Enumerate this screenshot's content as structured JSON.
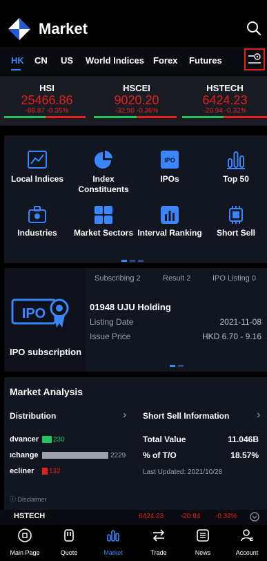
{
  "header": {
    "title": "Market",
    "search_icon": "search-icon"
  },
  "tabs": [
    {
      "label": "HK"
    },
    {
      "label": "CN"
    },
    {
      "label": "US"
    },
    {
      "label": "World Indices"
    },
    {
      "label": "Forex"
    },
    {
      "label": "Futures"
    }
  ],
  "indices": [
    {
      "name": "HSI",
      "value": "25466.86",
      "change": "-88.87 -0.35%"
    },
    {
      "name": "HSCEI",
      "value": "9020.20",
      "change": "-32.50 -0.36%"
    },
    {
      "name": "HSTECH",
      "value": "6424.23",
      "change": "-20.94 -0.32%"
    }
  ],
  "grid": [
    {
      "label": "Local Indices",
      "icon": "chart-line-icon"
    },
    {
      "label": "Index Constituents",
      "icon": "pie-chart-icon"
    },
    {
      "label": "IPOs",
      "icon": "ipo-icon"
    },
    {
      "label": "Top 50",
      "icon": "bar-chart-icon"
    },
    {
      "label": "Industries",
      "icon": "briefcase-icon"
    },
    {
      "label": "Market Sectors",
      "icon": "grid-icon"
    },
    {
      "label": "Interval Ranking",
      "icon": "ranking-icon"
    },
    {
      "label": "Short Sell",
      "icon": "chip-icon"
    }
  ],
  "ipo": {
    "tabs": [
      "Subscribing 2",
      "Result 2",
      "IPO Listing 0"
    ],
    "label": "IPO subscription",
    "item_title": "01948 UJU Holding",
    "listing_date_key": "Listing Date",
    "listing_date_val": "2021-11-08",
    "issue_price_key": "Issue Price",
    "issue_price_val": "HKD 6.70 - 9.16"
  },
  "analysis": {
    "title": "Market Analysis",
    "distribution": "Distribution",
    "short_sell_info": "Short Sell Information",
    "advancers_label": "dvancer",
    "advancers_count": "230",
    "unchanged_label": "ıchange",
    "unchanged_count": "2229",
    "decliners_label": "ecliner",
    "decliners_count": "132",
    "total_value_label": "Total Value",
    "total_value": "11.046B",
    "pct_to_label": "% of T/O",
    "pct_to": "18.57%",
    "last_updated": "Last Updated: 2021/10/28",
    "disclaimer": "ⓘ Disclaimer"
  },
  "ticker": {
    "name": "HSTECH",
    "value": "6424.23",
    "change": "-20.94",
    "pct": "-0.32%"
  },
  "nav": [
    {
      "label": "Main Page",
      "icon": "home-icon"
    },
    {
      "label": "Quote",
      "icon": "quote-icon"
    },
    {
      "label": "Market",
      "icon": "market-icon"
    },
    {
      "label": "Trade",
      "icon": "trade-icon"
    },
    {
      "label": "News",
      "icon": "news-icon"
    },
    {
      "label": "Account",
      "icon": "account-icon"
    }
  ],
  "colors": {
    "accent": "#3a86ff",
    "down": "#e4201d",
    "up": "#22c55e"
  }
}
